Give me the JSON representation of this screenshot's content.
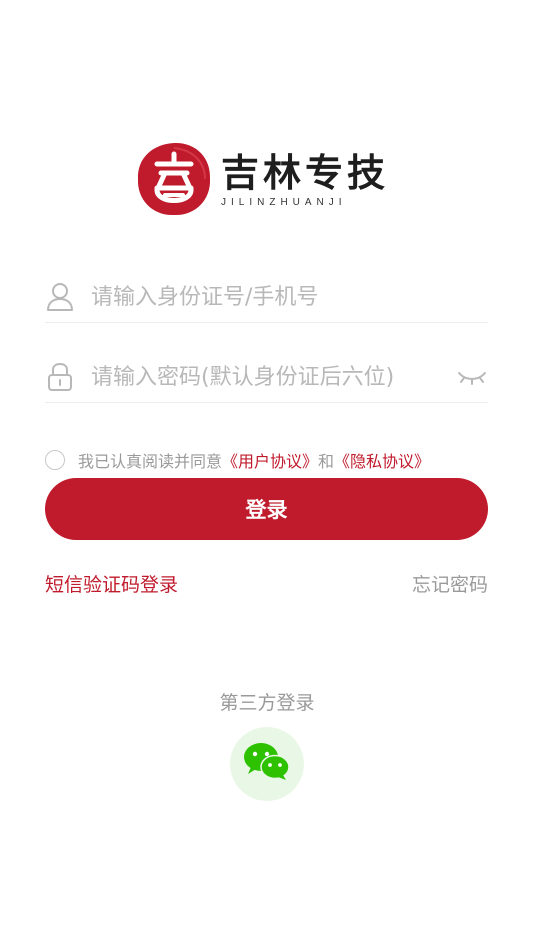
{
  "logo": {
    "title": "吉林专技",
    "subtitle": "JILINZHUANJI",
    "brand_color": "#c01b2c"
  },
  "id_field": {
    "placeholder": "请输入身份证号/手机号",
    "icon": "user-icon"
  },
  "password_field": {
    "placeholder": "请输入密码(默认身份证后六位)",
    "icon": "lock-icon",
    "toggle_icon": "eye-closed-icon"
  },
  "agreement": {
    "prefix": "我已认真阅读并同意",
    "user_agreement": "《用户协议》",
    "and": "和",
    "privacy_agreement": "《隐私协议》",
    "checked": false
  },
  "login_button": "登录",
  "sms_login": "短信验证码登录",
  "forgot_password": "忘记密码",
  "third_party": {
    "label": "第三方登录",
    "icon": "wechat-icon",
    "icon_color": "#2dc100"
  }
}
